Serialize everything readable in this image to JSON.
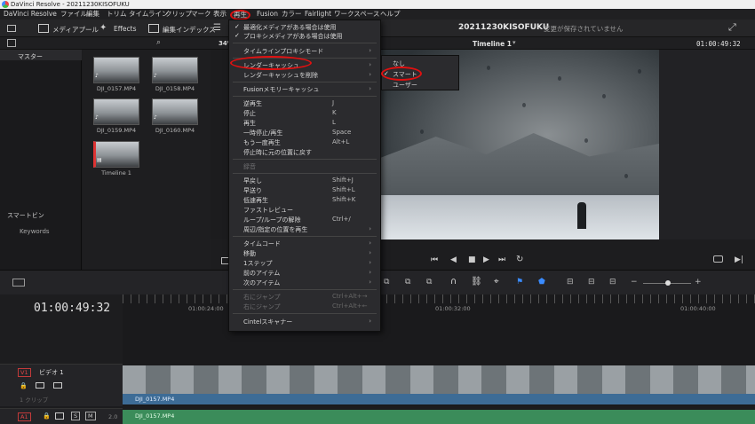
{
  "window": {
    "title": "DaVinci Resolve - 20211230KISOFUKU"
  },
  "menubar": {
    "items": [
      "DaVinci Resolve",
      "ファイル",
      "編集",
      "トリム",
      "タイムライン",
      "クリップ",
      "マーク",
      "表示",
      "再生",
      "Fusion",
      "カラー",
      "Fairlight",
      "ワークスペース",
      "ヘルプ"
    ]
  },
  "toolbar": {
    "media_pool": "メディアプール",
    "effects": "Effects",
    "edit_index": "編集インデックス",
    "zoom": "34%",
    "timeline_name": "Timeline 1",
    "timecode_right": "01:00:49:32"
  },
  "project": {
    "name": "20211230KISOFUKU",
    "status": "変更が保存されていません"
  },
  "left_panel": {
    "master": "マスター",
    "smart_bins": "スマートビン",
    "keywords": "Keywords"
  },
  "media": {
    "clips": [
      "DJI_0157.MP4",
      "DJI_0158.MP4",
      "DJI_0159.MP4",
      "DJI_0160.MP4",
      "Timeline 1"
    ]
  },
  "playback_menu": {
    "items": [
      {
        "label": "最適化メディアがある場合は使用",
        "checked": true
      },
      {
        "label": "プロキシメディアがある場合は使用",
        "checked": true
      },
      {
        "label": "タイムラインプロキシモード",
        "arrow": true
      },
      {
        "label": "レンダーキャッシュ",
        "arrow": true
      },
      {
        "label": "レンダーキャッシュを削除",
        "arrow": true
      },
      {
        "label": "Fusionメモリーキャッシュ",
        "arrow": true
      },
      {
        "label": "逆再生",
        "shortcut": "J"
      },
      {
        "label": "停止",
        "shortcut": "K"
      },
      {
        "label": "再生",
        "shortcut": "L"
      },
      {
        "label": "一時停止/再生",
        "shortcut": "Space"
      },
      {
        "label": "もう一度再生",
        "shortcut": "Alt+L"
      },
      {
        "label": "停止時に元の位置に戻す"
      },
      {
        "label": "録音",
        "disabled": true
      },
      {
        "label": "早戻し",
        "shortcut": "Shift+J"
      },
      {
        "label": "早送り",
        "shortcut": "Shift+L"
      },
      {
        "label": "低速再生",
        "shortcut": "Shift+K"
      },
      {
        "label": "ファストレビュー"
      },
      {
        "label": "ループ/ループの解除",
        "shortcut": "Ctrl+/"
      },
      {
        "label": "周辺/指定の位置を再生",
        "arrow": true
      },
      {
        "label": "タイムコード",
        "arrow": true
      },
      {
        "label": "移動",
        "arrow": true
      },
      {
        "label": "1ステップ",
        "arrow": true
      },
      {
        "label": "前のアイテム",
        "arrow": true
      },
      {
        "label": "次のアイテム",
        "arrow": true
      },
      {
        "label": "右にジャンプ",
        "shortcut": "Ctrl+Alt+→",
        "disabled": true
      },
      {
        "label": "右にジャンプ",
        "shortcut": "Ctrl+Alt+←",
        "disabled": true
      },
      {
        "label": "Cintelスキャナー",
        "arrow": true
      }
    ]
  },
  "render_cache_submenu": {
    "items": [
      {
        "label": "なし"
      },
      {
        "label": "スマート",
        "checked": true
      },
      {
        "label": "ユーザー"
      }
    ]
  },
  "timeline": {
    "timecode": "01:00:49:32",
    "ruler": [
      "01:00:24:00",
      "01:00:32:00",
      "01:00:40:00"
    ],
    "v1_label": "V1",
    "v1_name": "ビデオ 1",
    "v1_clips": "1 クリップ",
    "a1_label": "A1",
    "a1_level": "2.0",
    "clip_name": "DJI_0157.MP4"
  },
  "colors": {
    "accent_red": "#e01010",
    "video_track": "#3d6c96",
    "audio_track": "#3b8c5a"
  }
}
